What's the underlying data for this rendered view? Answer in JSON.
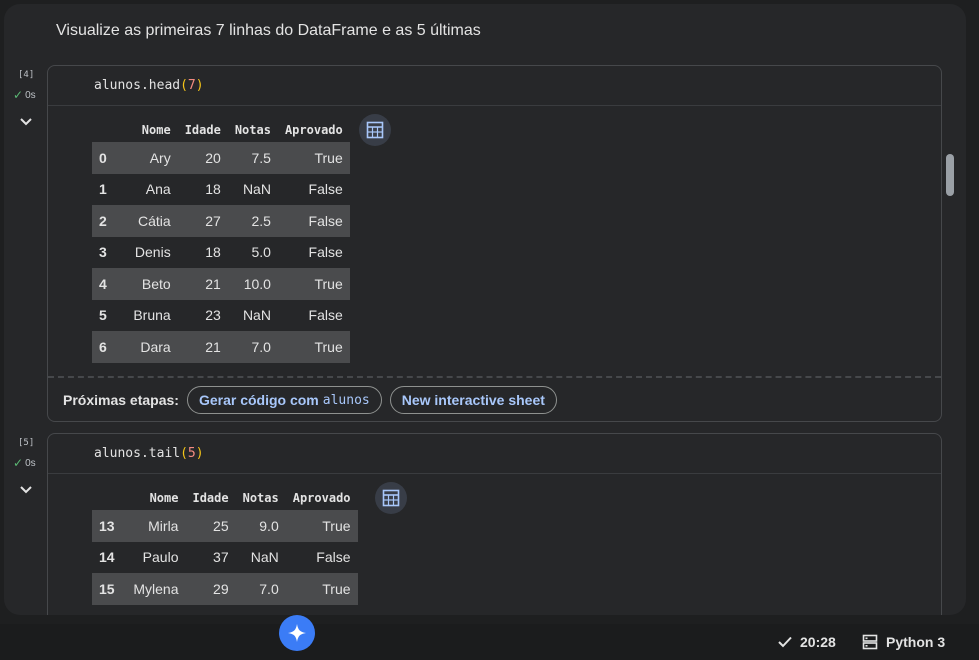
{
  "notebook": {
    "heading": "Visualize as primeiras 7 linhas do DataFrame e as 5 últimas"
  },
  "cells": [
    {
      "exec_count": "[4]",
      "status_time": "0s",
      "code": {
        "obj": "alunos.head",
        "open": "(",
        "arg": "7",
        "close": ")"
      },
      "columns": [
        "Nome",
        "Idade",
        "Notas",
        "Aprovado"
      ],
      "rows": [
        [
          "0",
          "Ary",
          "20",
          "7.5",
          "True"
        ],
        [
          "1",
          "Ana",
          "18",
          "NaN",
          "False"
        ],
        [
          "2",
          "Cátia",
          "27",
          "2.5",
          "False"
        ],
        [
          "3",
          "Denis",
          "18",
          "5.0",
          "False"
        ],
        [
          "4",
          "Beto",
          "21",
          "10.0",
          "True"
        ],
        [
          "5",
          "Bruna",
          "23",
          "NaN",
          "False"
        ],
        [
          "6",
          "Dara",
          "21",
          "7.0",
          "True"
        ]
      ],
      "next_steps": {
        "label": "Próximas etapas:",
        "chip1_text": "Gerar código com",
        "chip1_mono": "alunos",
        "chip2": "New interactive sheet"
      }
    },
    {
      "exec_count": "[5]",
      "status_time": "0s",
      "code": {
        "obj": "alunos.tail",
        "open": "(",
        "arg": "5",
        "close": ")"
      },
      "columns": [
        "Nome",
        "Idade",
        "Notas",
        "Aprovado"
      ],
      "rows": [
        [
          "13",
          "Mirla",
          "25",
          "9.0",
          "True"
        ],
        [
          "14",
          "Paulo",
          "37",
          "NaN",
          "False"
        ],
        [
          "15",
          "Mylena",
          "29",
          "7.0",
          "True"
        ]
      ]
    }
  ],
  "status_bar": {
    "time": "20:28",
    "runtime": "Python 3"
  },
  "icons": {
    "check": "check-icon",
    "collapse": "chevron-down-icon",
    "table": "table-icon",
    "gemini": "sparkle-icon",
    "runtime": "server-icon"
  },
  "colors": {
    "accent": "#a8c7fa",
    "success": "#5bb974",
    "gemini": "#3b7cf6"
  }
}
